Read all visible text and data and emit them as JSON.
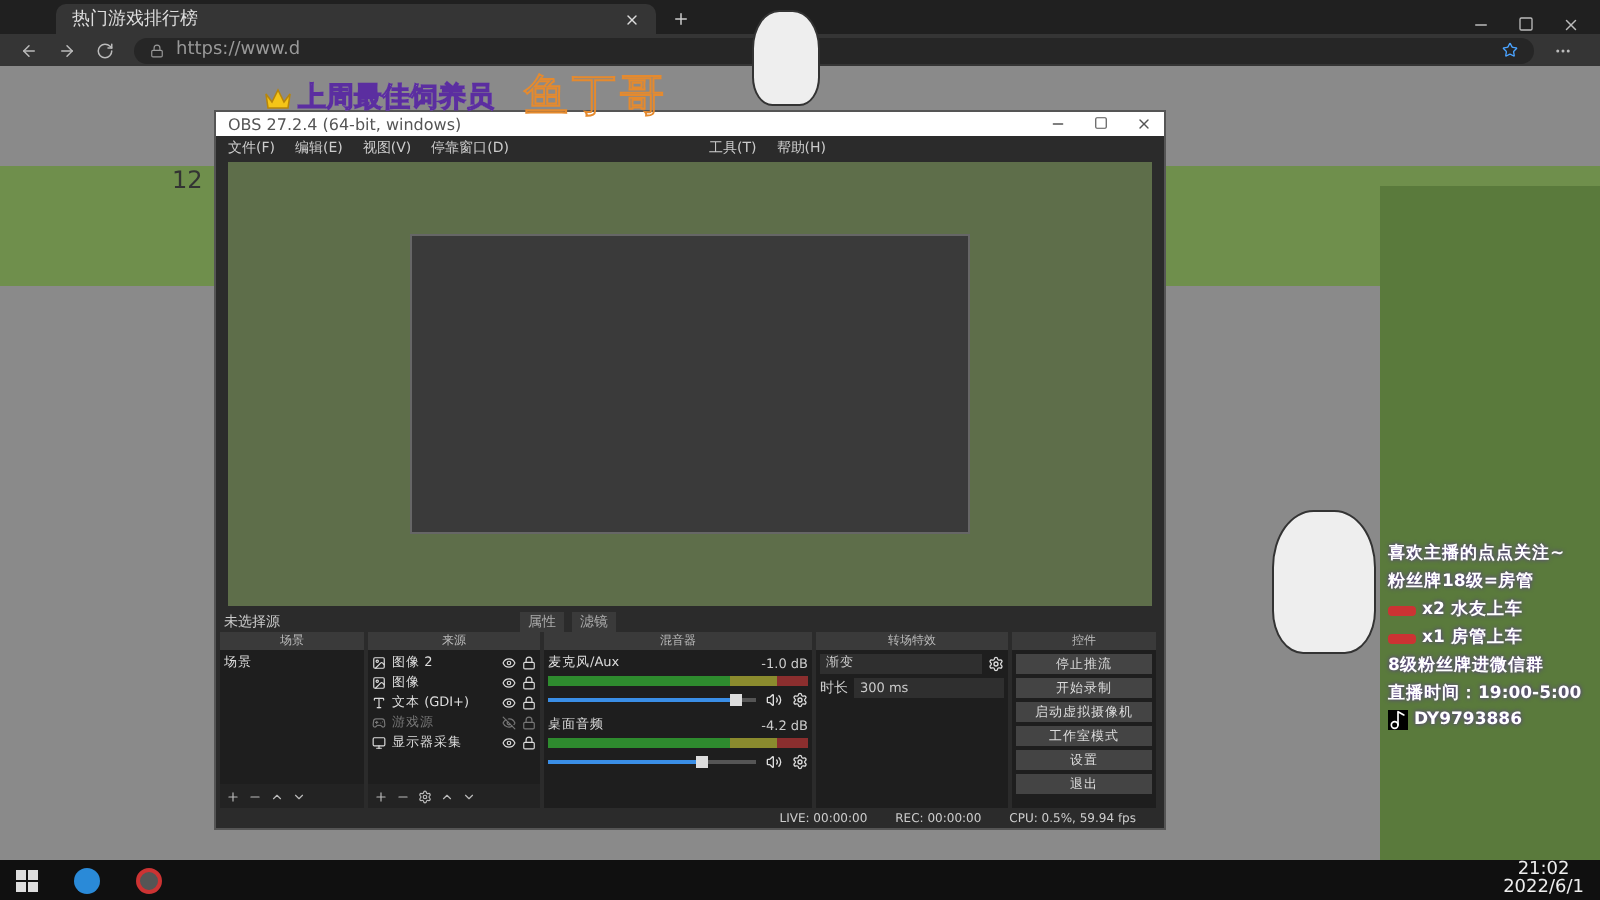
{
  "browser": {
    "tab_title": "热门游戏排行榜",
    "address": "https://www.d"
  },
  "page": {
    "counter": "12"
  },
  "overlay": {
    "banner": "上周最佳饲养员",
    "name": "鱼丁哥",
    "lines": [
      {
        "kind": "text",
        "text": "喜欢主播的点点关注~"
      },
      {
        "kind": "text",
        "text": "粉丝牌18级=房管"
      },
      {
        "kind": "car",
        "text": "x2 水友上车"
      },
      {
        "kind": "car",
        "text": "x1 房管上车"
      },
      {
        "kind": "text",
        "text": "8级粉丝牌进微信群"
      },
      {
        "kind": "text",
        "text": "直播时间：19:00-5:00"
      },
      {
        "kind": "tiktok",
        "text": "DY9793886"
      }
    ]
  },
  "obs": {
    "title": "OBS 27.2.4 (64-bit, windows)",
    "menu": [
      "文件(F)",
      "编辑(E)",
      "视图(V)",
      "停靠窗口(D)",
      "工具(T)",
      "帮助(H)"
    ],
    "source_label": "未选择源",
    "tool_buttons": [
      "属性",
      "滤镜"
    ],
    "docks": [
      "场景",
      "来源",
      "混音器",
      "转场特效",
      "控件"
    ],
    "scenes": [
      {
        "name": "场景",
        "selected": false
      }
    ],
    "sources": [
      {
        "name": "图像 2",
        "kind": "image",
        "visible": true
      },
      {
        "name": "图像",
        "kind": "image",
        "visible": true
      },
      {
        "name": "文本 (GDI+)",
        "kind": "text",
        "visible": true
      },
      {
        "name": "游戏源",
        "kind": "game",
        "visible": false
      },
      {
        "name": "显示器采集",
        "kind": "display",
        "visible": true
      }
    ],
    "mixer": [
      {
        "name": "麦克风/Aux",
        "reading": "-1.0 dB",
        "level": 0.9
      },
      {
        "name": "桌面音频",
        "reading": "-4.2 dB",
        "level": 0.74
      }
    ],
    "transition": {
      "value": "渐变",
      "duration_label": "时长",
      "duration": "300 ms"
    },
    "controls": [
      "停止推流",
      "开始录制",
      "启动虚拟摄像机",
      "工作室模式",
      "设置",
      "退出"
    ],
    "status": [
      "LIVE: 00:00:00",
      "REC: 00:00:00",
      "CPU: 0.5%, 59.94 fps"
    ]
  },
  "taskbar": {
    "time": "21:02",
    "date": "2022/6/1"
  }
}
